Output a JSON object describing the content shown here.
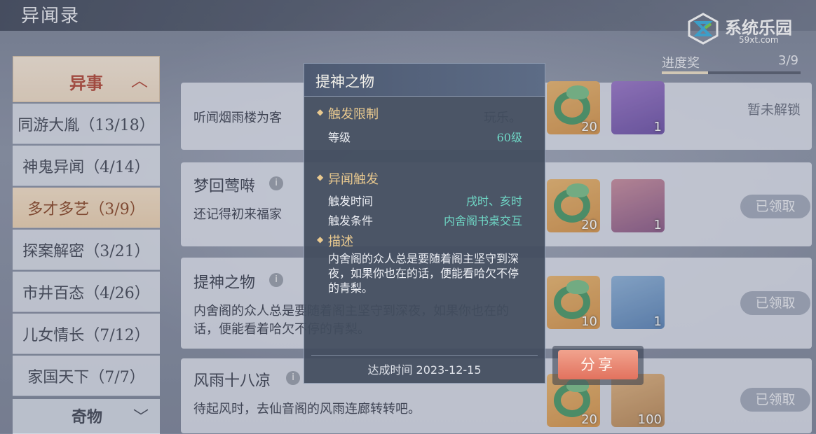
{
  "app_title": "异闻录",
  "logo": {
    "text": "系统乐园",
    "sub": "59xt.com"
  },
  "progress": {
    "label": "进度奖",
    "value": "3/9",
    "fraction": 0.333
  },
  "sidebar": {
    "header": "异事",
    "items": [
      {
        "label": "同游大胤（13/18）"
      },
      {
        "label": "神鬼异闻（4/14）"
      },
      {
        "label": "多才多艺（3/9）",
        "active": true
      },
      {
        "label": "探案解密（3/21）"
      },
      {
        "label": "市井百态（4/26）"
      },
      {
        "label": "儿女情长（7/12）"
      },
      {
        "label": "家国天下（7/7）"
      }
    ],
    "footer": "奇物"
  },
  "cards": [
    {
      "title": "",
      "desc": "听闻烟雨楼为客　　　　　　　　　　　　　　　　玩乐。",
      "rewards": [
        "20",
        "1"
      ],
      "status": "暂未解锁"
    },
    {
      "title": "梦回莺啭",
      "desc": "还记得初来福家",
      "rewards": [
        "20",
        "1"
      ],
      "status": "已领取"
    },
    {
      "title": "提神之物",
      "desc": "内舍阁的众人总是要随着阁主坚守到深夜，如果你也在的话，便能看着哈欠不停的青梨。",
      "rewards": [
        "10",
        "1"
      ],
      "status": "已领取"
    },
    {
      "title": "风雨十八凉",
      "desc": "待起风时，去仙音阁的风雨连廊转转吧。",
      "rewards": [
        "20",
        "100"
      ],
      "status": "已领取"
    }
  ],
  "popup": {
    "title": "提神之物",
    "section1": "触发限制",
    "level_label": "等级",
    "level_value": "60级",
    "section2": "异闻触发",
    "time_label": "触发时间",
    "time_value": "戌时、亥时",
    "cond_label": "触发条件",
    "cond_value": "内舍阁书桌交互",
    "section3": "描述",
    "desc": "内舍阁的众人总是要随着阁主坚守到深夜，如果你也在的话，便能看哈欠不停的青梨。",
    "date": "达成时间 2023-12-15"
  },
  "share_label": "分享"
}
